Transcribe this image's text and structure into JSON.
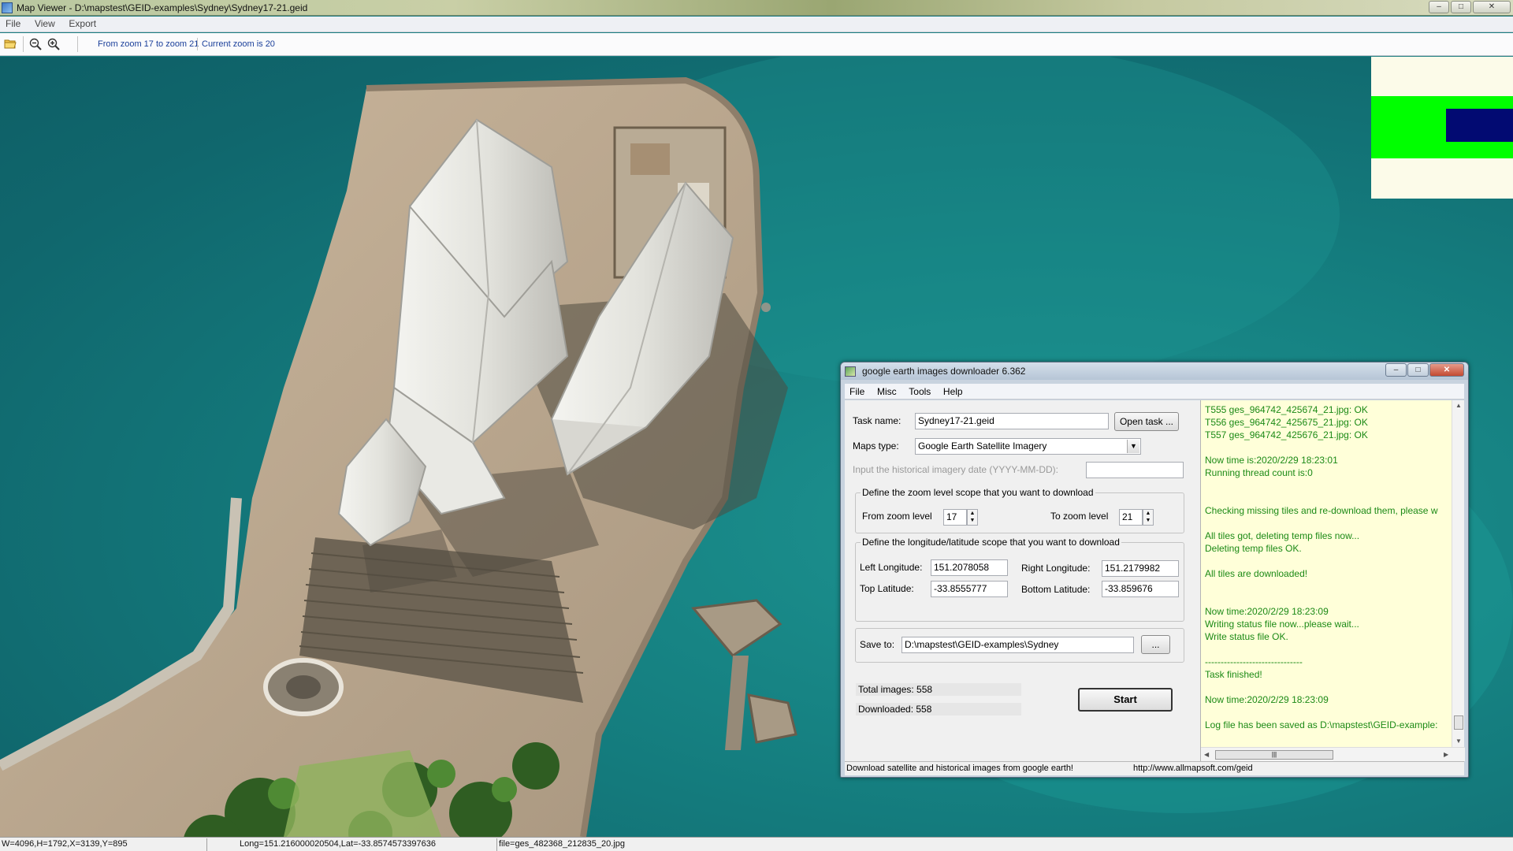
{
  "window": {
    "title": "Map Viewer - D:\\mapstest\\GEID-examples\\Sydney\\Sydney17-21.geid",
    "controls": [
      "–",
      "□",
      "✕"
    ]
  },
  "menu": [
    "File",
    "View",
    "Export"
  ],
  "toolbar": {
    "zoom_range": "From zoom 17 to zoom 21",
    "current_zoom": "Current zoom is 20"
  },
  "status": {
    "size": "W=4096,H=1792,X=3139,Y=895",
    "coords": "Long=151.216000020504,Lat=-33.8574573397636",
    "file": "file=ges_482368_212835_20.jpg"
  },
  "dialog": {
    "title": "google earth images downloader 6.362",
    "controls": [
      "–",
      "□",
      "✕"
    ],
    "menu": [
      "File",
      "Misc",
      "Tools",
      "Help"
    ],
    "task_label": "Task name:",
    "task_value": "Sydney17-21.geid",
    "open_task": "Open task ...",
    "maps_type_label": "Maps type:",
    "maps_type_value": "Google Earth Satellite Imagery",
    "hist_label": "Input the  historical imagery date (YYYY-MM-DD):",
    "hist_value": "",
    "zoom_group": "Define the zoom level scope that you want to download",
    "from_zoom_label": "From zoom level",
    "from_zoom_value": "17",
    "to_zoom_label": "To zoom level",
    "to_zoom_value": "21",
    "lonlat_group": "Define the longitude/latitude scope that you want to download",
    "left_lon_label": "Left Longitude:",
    "left_lon_value": "151.2078058",
    "right_lon_label": "Right Longitude:",
    "right_lon_value": "151.2179982",
    "top_lat_label": "Top Latitude:",
    "top_lat_value": "-33.8555777",
    "bottom_lat_label": "Bottom Latitude:",
    "bottom_lat_value": "-33.859676",
    "save_label": "Save to:",
    "save_value": "D:\\mapstest\\GEID-examples\\Sydney",
    "browse": "...",
    "total_images": "Total images: 558",
    "downloaded": "Downloaded: 558",
    "start": "Start",
    "status_left": "Download satellite and historical  images from google earth!",
    "status_right": "http://www.allmapsoft.com/geid",
    "log": [
      "T555 ges_964742_425674_21.jpg:  OK",
      "T556 ges_964742_425675_21.jpg:  OK",
      "T557 ges_964742_425676_21.jpg:  OK",
      "",
      "Now time is:2020/2/29 18:23:01",
      "Running thread count is:0",
      "",
      "",
      "Checking missing tiles and re-download them, please w",
      "",
      "All tiles got, deleting temp files now...",
      "Deleting temp files OK.",
      "",
      "All tiles are downloaded!",
      "",
      "",
      "Now time:2020/2/29 18:23:09",
      "Writing status file now...please wait...",
      "Write status file OK.",
      "",
      "-------------------------------",
      "Task finished!",
      "",
      "Now time:2020/2/29 18:23:09",
      "",
      "Log file has been saved as D:\\mapstest\\GEID-example:"
    ]
  },
  "colors": {
    "water": "#157f80",
    "overview_green": "#00ff00",
    "overview_navy": "#020a72",
    "log_text": "#1c8a16",
    "log_bg": "#ffffd9"
  }
}
